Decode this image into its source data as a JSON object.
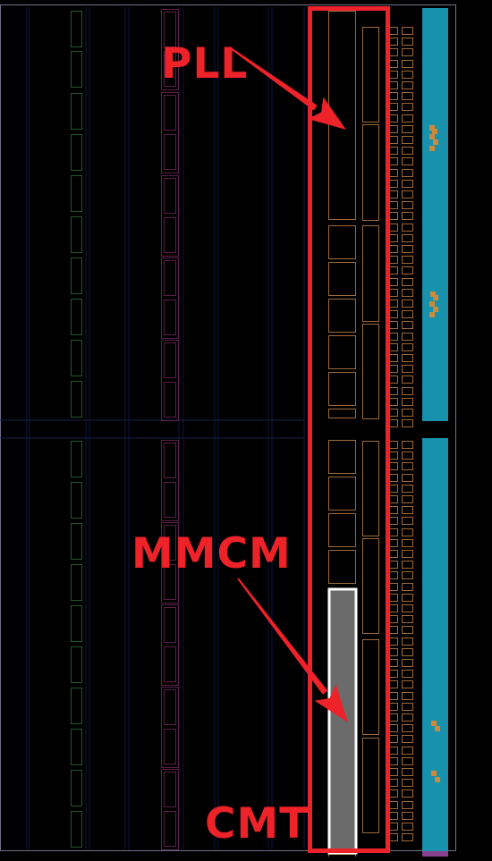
{
  "labels": {
    "pll": "PLL",
    "mmcm": "MMCM",
    "cmt": "CMT"
  },
  "colors": {
    "background": "#000000",
    "annotation_red": "#ee2229",
    "io_column": "#1891ad",
    "io_bottom_strip": "#8a3f8f",
    "orange_site": "#cc8a3a",
    "mmcm_fill": "#6b6b6b",
    "selection_white": "#ffffff",
    "tile_outline_orange": "#9c6a3a",
    "tile_outline_green": "#1f5a2a",
    "tile_outline_purple": "#5a1f4a",
    "tile_outline_navy": "#0d1642",
    "frame_border": "#70708a"
  }
}
